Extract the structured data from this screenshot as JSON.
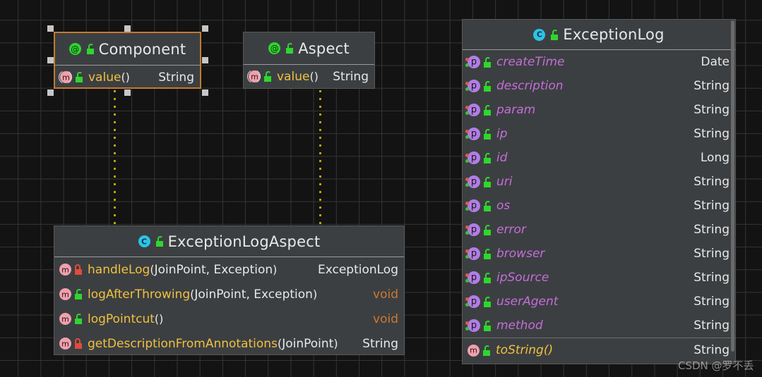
{
  "canvas": {
    "background_color": "#131313",
    "grid_color": "#343434",
    "grid_size": 32
  },
  "watermark": {
    "text": "CSDN @罗不丢",
    "color": "#ebebeb"
  },
  "connectors": [
    {
      "name": "component-to-aspectclass-dependency",
      "style": "dotted",
      "color": "#b5a50b"
    },
    {
      "name": "aspect-to-aspectclass-dependency",
      "style": "dotted",
      "color": "#b5a50b"
    }
  ],
  "classes": [
    {
      "id": "component",
      "name": "Component",
      "stereotype": "annotation",
      "selected": true,
      "header_icons": [
        "annotation-icon",
        "lock-open-icon"
      ],
      "members": [
        {
          "icons": [
            "method-icon",
            "lock-open-icon"
          ],
          "name": "value",
          "parens": "()",
          "args": "",
          "type": "String",
          "type_style": "plain",
          "name_style": "method"
        }
      ]
    },
    {
      "id": "aspect",
      "name": "Aspect",
      "stereotype": "annotation",
      "selected": false,
      "header_icons": [
        "annotation-icon",
        "lock-open-icon"
      ],
      "members": [
        {
          "icons": [
            "method-icon",
            "lock-open-icon"
          ],
          "name": "value",
          "parens": "()",
          "args": "",
          "type": "String",
          "type_style": "plain",
          "name_style": "method"
        }
      ]
    },
    {
      "id": "exception-log-aspect",
      "name": "ExceptionLogAspect",
      "stereotype": "class",
      "selected": false,
      "header_icons": [
        "class-icon",
        "lock-open-icon"
      ],
      "members": [
        {
          "icons": [
            "method-icon",
            "lock-closed-icon"
          ],
          "name": "handleLog",
          "parens": "()",
          "args": "JoinPoint, Exception",
          "type": "ExceptionLog",
          "type_style": "plain",
          "name_style": "method"
        },
        {
          "icons": [
            "method-icon",
            "lock-open-icon"
          ],
          "name": "logAfterThrowing",
          "parens": "()",
          "args": "JoinPoint, Exception",
          "type": "void",
          "type_style": "void",
          "name_style": "method"
        },
        {
          "icons": [
            "method-icon",
            "lock-open-icon"
          ],
          "name": "logPointcut",
          "parens": "()",
          "args": "",
          "type": "void",
          "type_style": "void",
          "name_style": "method"
        },
        {
          "icons": [
            "method-icon",
            "lock-closed-icon"
          ],
          "name": "getDescriptionFromAnnotations",
          "parens": "()",
          "args": "JoinPoint",
          "type": "String",
          "type_style": "plain",
          "name_style": "method"
        }
      ]
    },
    {
      "id": "exception-log",
      "name": "ExceptionLog",
      "stereotype": "class",
      "selected": false,
      "header_icons": [
        "class-icon",
        "lock-open-icon"
      ],
      "members": [
        {
          "icons": [
            "property-icon",
            "lock-open-icon"
          ],
          "name": "createTime",
          "parens": "",
          "args": "",
          "type": "Date",
          "type_style": "plain",
          "name_style": "property"
        },
        {
          "icons": [
            "property-icon",
            "lock-open-icon"
          ],
          "name": "description",
          "parens": "",
          "args": "",
          "type": "String",
          "type_style": "plain",
          "name_style": "property"
        },
        {
          "icons": [
            "property-icon",
            "lock-open-icon"
          ],
          "name": "param",
          "parens": "",
          "args": "",
          "type": "String",
          "type_style": "plain",
          "name_style": "property"
        },
        {
          "icons": [
            "property-icon",
            "lock-open-icon"
          ],
          "name": "ip",
          "parens": "",
          "args": "",
          "type": "String",
          "type_style": "plain",
          "name_style": "property"
        },
        {
          "icons": [
            "property-icon",
            "lock-open-icon"
          ],
          "name": "id",
          "parens": "",
          "args": "",
          "type": "Long",
          "type_style": "plain",
          "name_style": "property"
        },
        {
          "icons": [
            "property-icon",
            "lock-open-icon"
          ],
          "name": "uri",
          "parens": "",
          "args": "",
          "type": "String",
          "type_style": "plain",
          "name_style": "property"
        },
        {
          "icons": [
            "property-icon",
            "lock-open-icon"
          ],
          "name": "os",
          "parens": "",
          "args": "",
          "type": "String",
          "type_style": "plain",
          "name_style": "property"
        },
        {
          "icons": [
            "property-icon",
            "lock-open-icon"
          ],
          "name": "error",
          "parens": "",
          "args": "",
          "type": "String",
          "type_style": "plain",
          "name_style": "property"
        },
        {
          "icons": [
            "property-icon",
            "lock-open-icon"
          ],
          "name": "browser",
          "parens": "",
          "args": "",
          "type": "String",
          "type_style": "plain",
          "name_style": "property"
        },
        {
          "icons": [
            "property-icon",
            "lock-open-icon"
          ],
          "name": "ipSource",
          "parens": "",
          "args": "",
          "type": "String",
          "type_style": "plain",
          "name_style": "property"
        },
        {
          "icons": [
            "property-icon",
            "lock-open-icon"
          ],
          "name": "userAgent",
          "parens": "",
          "args": "",
          "type": "String",
          "type_style": "plain",
          "name_style": "property"
        },
        {
          "icons": [
            "property-icon",
            "lock-open-icon"
          ],
          "name": "method",
          "parens": "",
          "args": "",
          "type": "String",
          "type_style": "plain",
          "name_style": "property"
        },
        {
          "icons": [
            "method-icon",
            "lock-open-icon"
          ],
          "name": "toString",
          "parens": "()",
          "args": "",
          "type": "String",
          "type_style": "plain",
          "name_style": "method",
          "section_break": true
        }
      ]
    }
  ],
  "colors": {
    "box_fill": "#3c3f41",
    "box_border": "#585858",
    "selection_border": "#c47a2e",
    "handle": "#c6c6c6",
    "method_name": "#f0c040",
    "property_name": "#c46ddb",
    "type_text": "#e8e8e8",
    "void_type": "#cc7832",
    "annotation_icon": "#2fd62f",
    "class_icon": "#2bc4e8",
    "method_icon": "#f0a0ad",
    "property_icon": "#b07fe0",
    "lock_open": "#2fd62f",
    "lock_closed": "#e04b3c"
  }
}
